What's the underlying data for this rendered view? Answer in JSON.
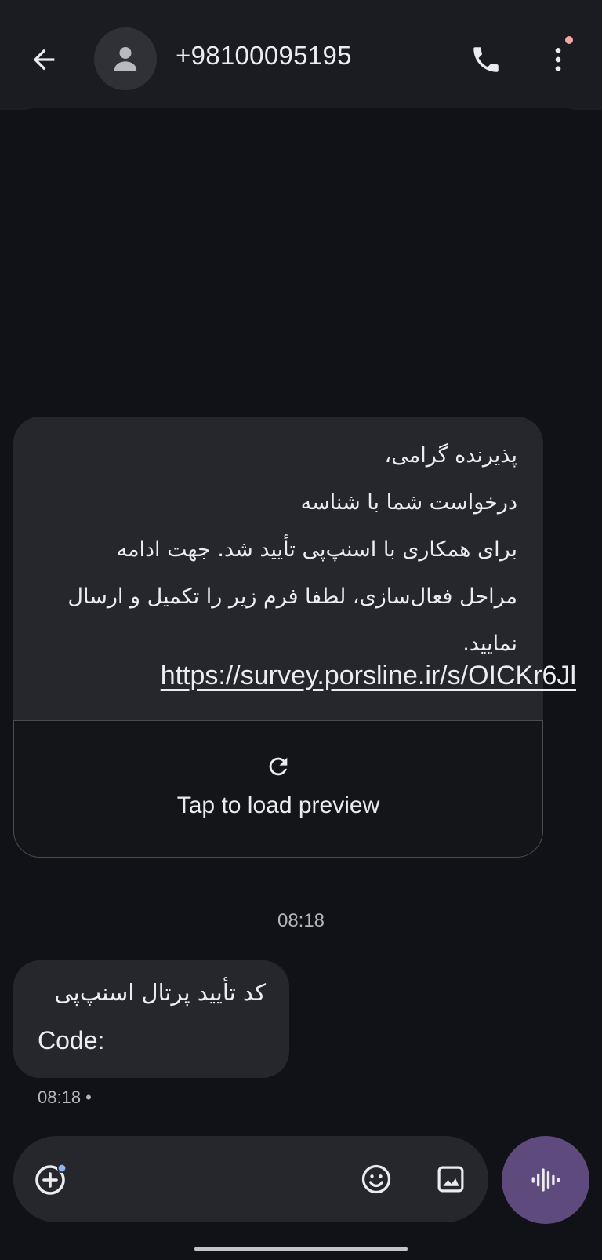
{
  "header": {
    "back_icon": "arrow-left-icon",
    "contact_name": "+98100095195",
    "avatar_icon": "person-icon",
    "call_icon": "phone-icon",
    "more_icon": "more-vert-icon",
    "notification_dot_color": "#f0a9a4"
  },
  "messages": [
    {
      "lines": [
        "پذیرنده گرامی،",
        "درخواست شما با شناسه",
        "برای همکاری با اسنپ‌پی تأیید شد. جهت ادامه",
        "مراحل فعال‌سازی، لطفا فرم زیر را تکمیل و ارسال",
        "نمایید."
      ],
      "link": "https://survey.porsline.ir/s/OICKr6Jl",
      "preview": {
        "icon": "refresh-icon",
        "label": "Tap to load preview"
      }
    },
    {
      "line1": "کد تأیید پرتال اسنپ‌پی",
      "line2": "Code:"
    }
  ],
  "timestamp_divider": "08:18",
  "last_message_meta": "08:18 •",
  "compose": {
    "add_icon": "add-circle-icon",
    "emoji_icon": "emoji-icon",
    "gallery_icon": "image-icon",
    "voice_icon": "voice-waveform-icon",
    "voice_button_color": "#5e4a7c"
  }
}
